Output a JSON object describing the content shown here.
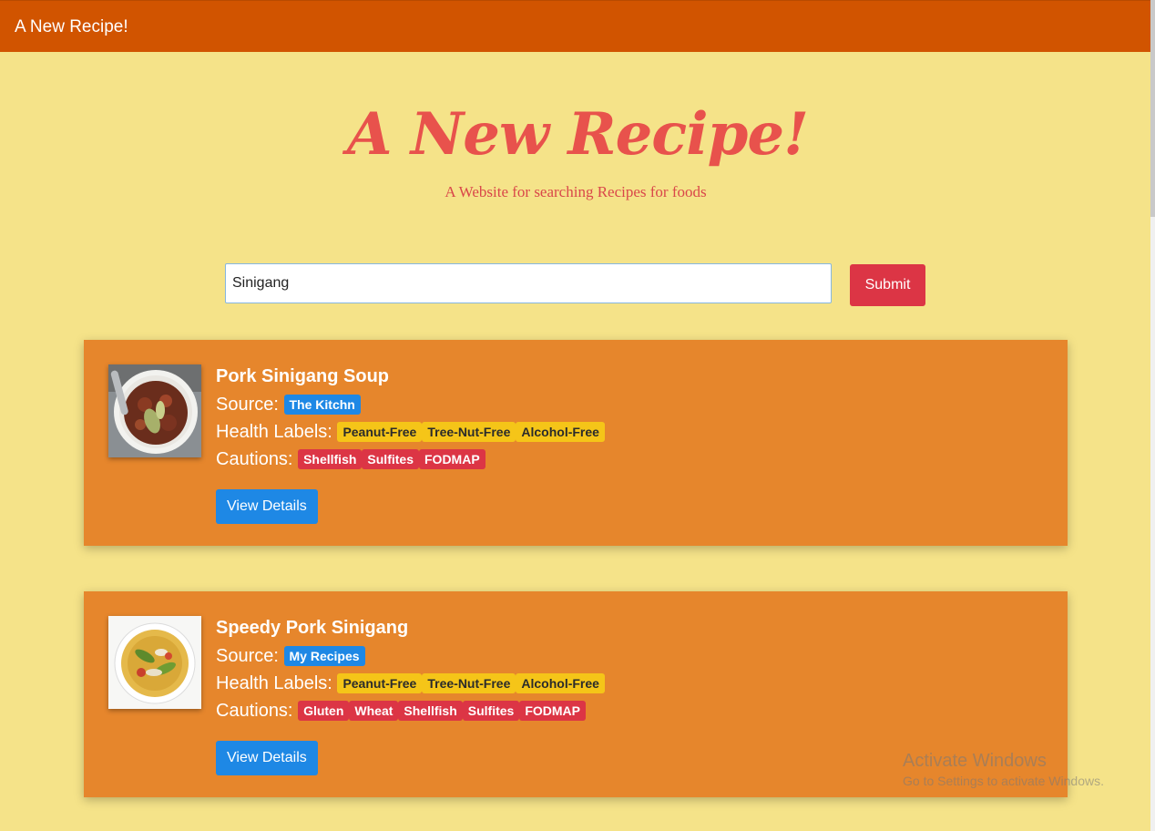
{
  "navbar": {
    "brand": "A New Recipe!"
  },
  "hero": {
    "title": "A New Recipe!",
    "subtitle": "A Website for searching Recipes for foods"
  },
  "search": {
    "value": "Sinigang",
    "submit_label": "Submit"
  },
  "labels": {
    "source": "Source:",
    "health": "Health Labels:",
    "cautions": "Cautions:",
    "view_details": "View Details"
  },
  "recipes": [
    {
      "title": "Pork Sinigang Soup",
      "source": "The Kitchn",
      "health_labels": [
        "Peanut-Free",
        "Tree-Nut-Free",
        "Alcohol-Free"
      ],
      "cautions": [
        "Shellfish",
        "Sulfites",
        "FODMAP"
      ]
    },
    {
      "title": "Speedy Pork Sinigang",
      "source": "My Recipes",
      "health_labels": [
        "Peanut-Free",
        "Tree-Nut-Free",
        "Alcohol-Free"
      ],
      "cautions": [
        "Gluten",
        "Wheat",
        "Shellfish",
        "Sulfites",
        "FODMAP"
      ]
    }
  ],
  "watermark": {
    "line1": "Activate Windows",
    "line2": "Go to Settings to activate Windows."
  },
  "colors": {
    "navbar": "#d15400",
    "background": "#f5e389",
    "card": "#e6862c",
    "accent_red": "#dc3545",
    "accent_blue": "#1e88e5",
    "accent_yellow": "#f5c518"
  }
}
